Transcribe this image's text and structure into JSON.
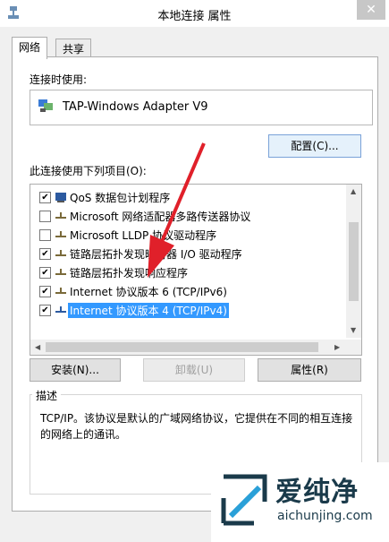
{
  "window": {
    "title": "本地连接 属性",
    "close_glyph": "✕"
  },
  "tabs": [
    {
      "label": "网络"
    },
    {
      "label": "共享"
    }
  ],
  "connect_using": {
    "label": "连接时使用:",
    "adapter": "TAP-Windows Adapter V9"
  },
  "buttons": {
    "configure": "配置(C)...",
    "install": "安装(N)...",
    "uninstall": "卸载(U)",
    "properties": "属性(R)"
  },
  "items_label": "此连接使用下列项目(O):",
  "items": [
    {
      "label": "QoS 数据包计划程序",
      "checked": true,
      "icon": "qos-icon"
    },
    {
      "label": "Microsoft 网络适配器多路传送器协议",
      "checked": false,
      "icon": "protocol-icon"
    },
    {
      "label": "Microsoft LLDP 协议驱动程序",
      "checked": false,
      "icon": "protocol-icon"
    },
    {
      "label": "链路层拓扑发现映射器 I/O 驱动程序",
      "checked": true,
      "icon": "protocol-icon"
    },
    {
      "label": "链路层拓扑发现响应程序",
      "checked": true,
      "icon": "protocol-icon"
    },
    {
      "label": "Internet 协议版本 6 (TCP/IPv6)",
      "checked": true,
      "icon": "protocol-icon"
    },
    {
      "label": "Internet 协议版本 4 (TCP/IPv4)",
      "checked": true,
      "icon": "protocol-icon",
      "selected": true
    }
  ],
  "description": {
    "label": "描述",
    "text": "TCP/IP。该协议是默认的广域网络协议，它提供在不同的相互连接的网络上的通讯。"
  },
  "watermark": {
    "text": "爱纯净",
    "url": "aichunjing.com"
  },
  "colors": {
    "selection": "#3399ff",
    "arrow": "#e0202a",
    "dialog_bg": "#f0f0f0"
  }
}
